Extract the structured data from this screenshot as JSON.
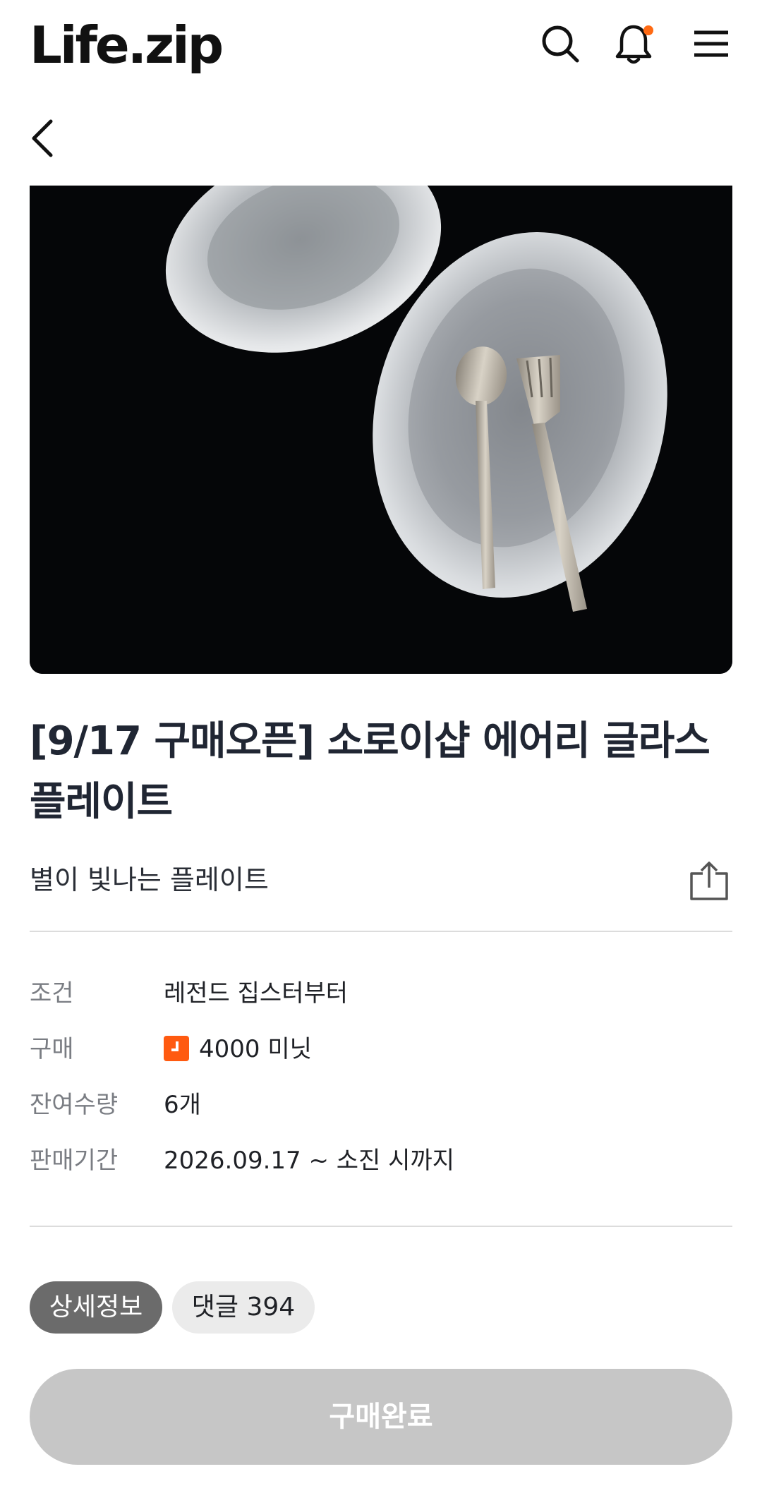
{
  "header": {
    "logo": "Life.zip",
    "icons": [
      "search-icon",
      "bell-icon",
      "menu-icon"
    ],
    "notification_dot_color": "#ff6a13"
  },
  "product": {
    "title": "[9/17 구매오픈] 소로이샵 에어리 글라스 플레이트",
    "subtitle": "별이 빛나는 플레이트"
  },
  "info": {
    "condition_label": "조건",
    "condition_value": "레전드 집스터부터",
    "purchase_label": "구매",
    "purchase_value": "4000 미닛",
    "stock_label": "잔여수량",
    "stock_value": "6개",
    "period_label": "판매기간",
    "period_value": "2026.09.17 ~ 소진 시까지"
  },
  "tabs": {
    "detail": "상세정보",
    "comments": "댓글 394"
  },
  "cta": {
    "label": "구매완료"
  },
  "colors": {
    "accent": "#ff5a10",
    "cta_disabled": "#c6c6c6",
    "tab_active": "#6b6b6b"
  }
}
